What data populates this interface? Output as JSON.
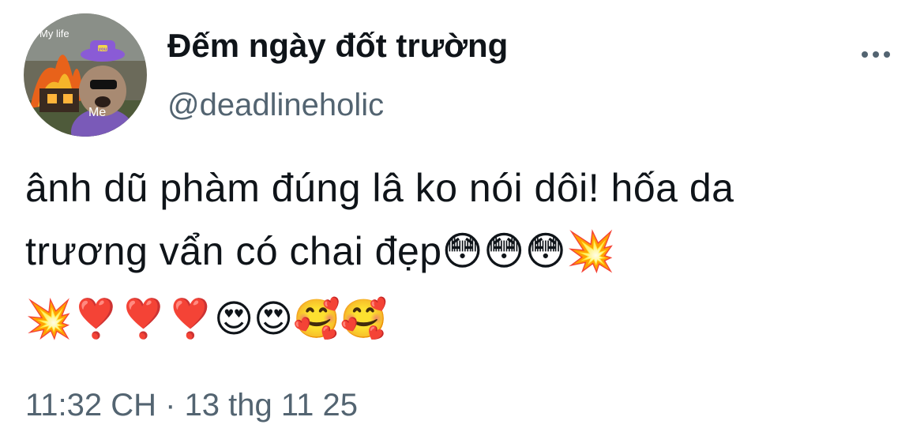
{
  "user": {
    "display_name": "Đếm ngày đốt trường",
    "handle": "@deadlineholic",
    "avatar_caption_top": "My life",
    "avatar_caption_bottom": "Me",
    "avatar_hat_label": "you"
  },
  "more_icon": "more-horizontal-icon",
  "tweet": {
    "text": "ânh dũ phàm đúng lâ ko nói dôi! hốa da\ntrương vẩn có chai đẹp😳😳😳💥",
    "emoji_line": "💥❣️❣️❣️😍😍🥰🥰",
    "timestamp": "11:32 CH · 13 thg 11 25"
  },
  "colors": {
    "text_primary": "#0f1419",
    "text_secondary": "#536471",
    "background": "#ffffff"
  }
}
